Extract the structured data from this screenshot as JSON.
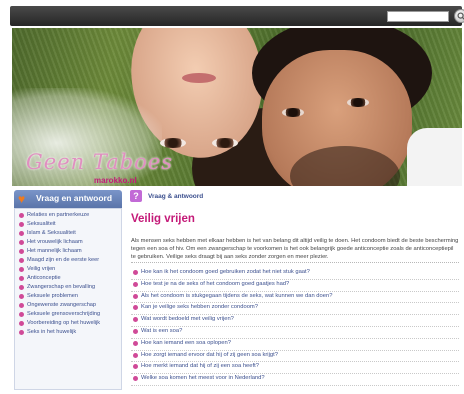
{
  "search": {
    "placeholder": ""
  },
  "branding": {
    "logo_text": "Geen Taboes",
    "site": "marokko.nl"
  },
  "sidebar": {
    "title": "Vraag en antwoord",
    "items": [
      {
        "label": "Relaties en partnerkeuze"
      },
      {
        "label": "Seksualiteit"
      },
      {
        "label": "Islam & Seksualiteit"
      },
      {
        "label": "Het vrouwelijk lichaam"
      },
      {
        "label": "Het mannelijk lichaam"
      },
      {
        "label": "Maagd zijn en de eerste keer"
      },
      {
        "label": "Veilig vrijen"
      },
      {
        "label": "Anticonceptie"
      },
      {
        "label": "Zwangerschap en bevalling"
      },
      {
        "label": "Seksuele problemen"
      },
      {
        "label": "Ongewenste zwangerschap"
      },
      {
        "label": "Seksuele grensoverschrijding"
      },
      {
        "label": "Voorbereiding op het huwelijk"
      },
      {
        "label": "Seks in het huwelijk"
      }
    ]
  },
  "main": {
    "crumb": "Vraag & antwoord",
    "title": "Veilig vrijen",
    "intro": "Als mensen seks hebben met elkaar hebben is het van belang dit altijd veilig te doen. Het condoom biedt de beste bescherming tegen een soa of hiv. Om een zwangerschap te voorkomen is het ook belangrijk goede anticonceptie zoals de anticonceptiepil te gebruiken. Veilige seks draagt bij aan seks zonder zorgen en meer plezier.",
    "questions": [
      {
        "label": "Hoe kan ik het condoom goed gebruiken zodat het niet stuk gaat?"
      },
      {
        "label": "Hoe test je na de seks of het condoom goed gaatjes had?"
      },
      {
        "label": "Als het condoom is stukgegaan tijdens de seks, wat kunnen we dan doen?"
      },
      {
        "label": "Kan je veilige seks hebben zonder condoom?"
      },
      {
        "label": "Wat wordt bedoeld met veilig vrijen?"
      },
      {
        "label": "Wat is een soa?"
      },
      {
        "label": "Hoe kan iemand een soa oplopen?"
      },
      {
        "label": "Hoe zorgt iemand ervoor dat hij of zij geen soa krijgt?"
      },
      {
        "label": "Hoe merkt iemand dat hij of zij een soa heeft?"
      },
      {
        "label": "Welke soa komen het meest voor in Nederland?"
      }
    ]
  },
  "colors": {
    "accent": "#c41a78",
    "link": "#3b4f8e",
    "sidebar_head": "#5a74a9"
  }
}
